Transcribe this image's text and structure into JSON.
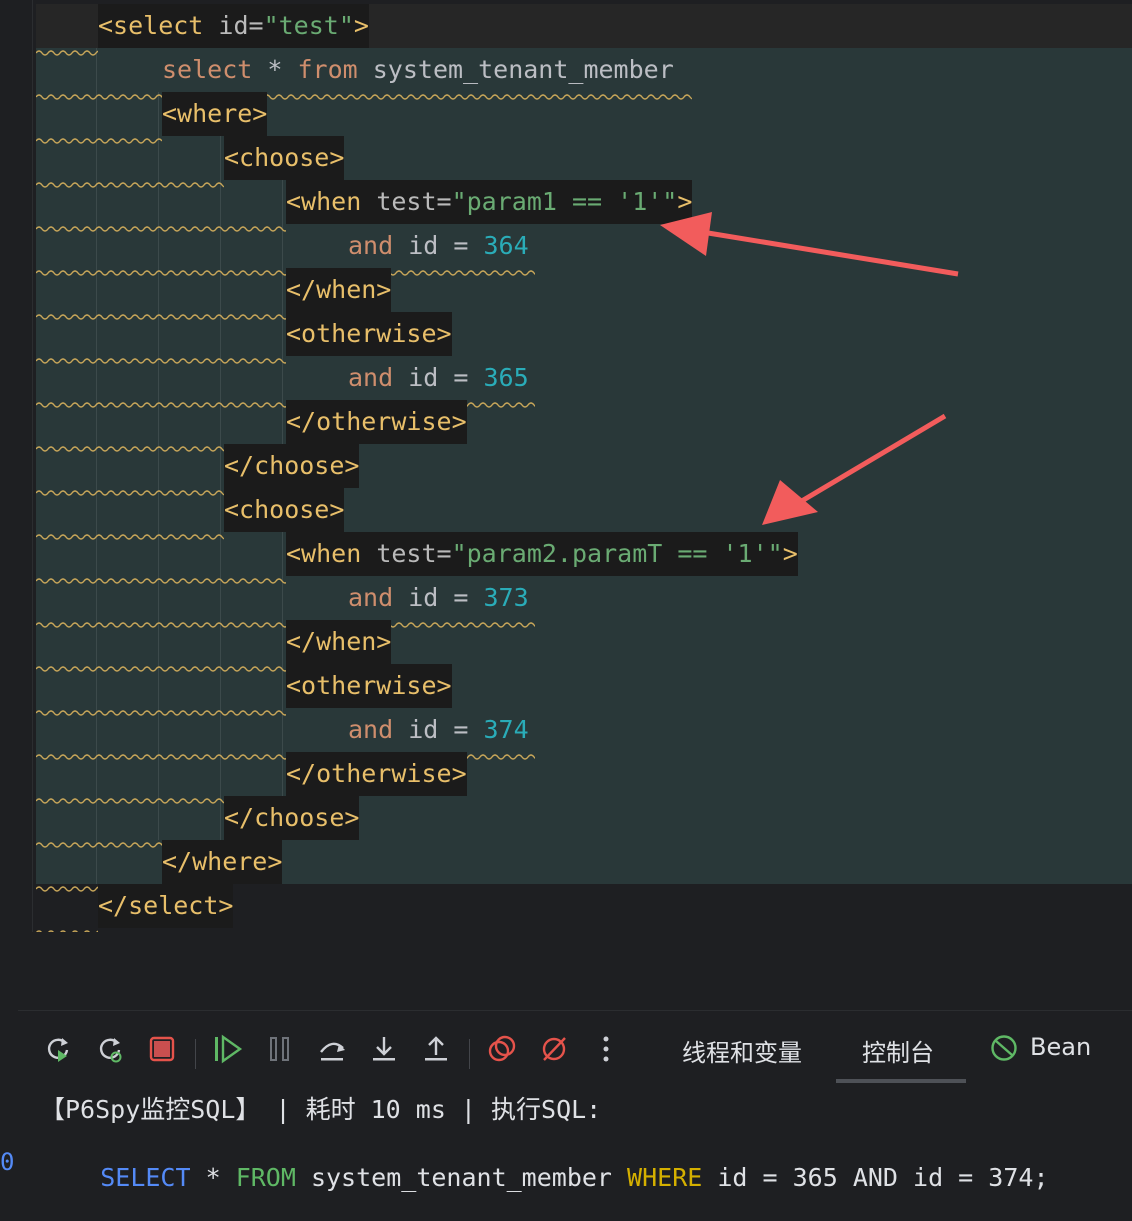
{
  "editor": {
    "lines": [
      {
        "t": "<select",
        "a": " id=",
        "s": "\"test\"",
        "t2": ">"
      },
      {
        "k": "select",
        "op": " * ",
        "k2": "from",
        "i": " system_tenant_member"
      },
      {
        "t": "<where>"
      },
      {
        "t": "<choose>"
      },
      {
        "t": "<when",
        "a": " test=",
        "s": "\"param1 == '1'\"",
        "t2": ">"
      },
      {
        "k": "and",
        "i": " id = ",
        "n": "364"
      },
      {
        "t": "</when>"
      },
      {
        "t": "<otherwise>"
      },
      {
        "k": "and",
        "i": " id = ",
        "n": "365"
      },
      {
        "t": "</otherwise>"
      },
      {
        "t": "</choose>"
      },
      {
        "t": "<choose>"
      },
      {
        "t": "<when",
        "a": " test=",
        "s": "\"param2.paramT == '1'\"",
        "t2": ">"
      },
      {
        "k": "and",
        "i": " id = ",
        "n": "373"
      },
      {
        "t": "</when>"
      },
      {
        "t": "<otherwise>"
      },
      {
        "k": "and",
        "i": " id = ",
        "n": "374"
      },
      {
        "t": "</otherwise>"
      },
      {
        "t": "</choose>"
      },
      {
        "t": "</where>"
      },
      {
        "t": "</select>"
      }
    ]
  },
  "debug_toolbar": {
    "tabs": [
      {
        "label": "线程和变量"
      },
      {
        "label": "控制台"
      },
      {
        "label": "Bean"
      }
    ]
  },
  "console": {
    "line1": "【P6Spy监控SQL】 | 耗时 10 ms | 执行SQL:",
    "sql": {
      "select": "SELECT",
      "star": " * ",
      "from": "FROM",
      "table": " system_tenant_member ",
      "where": "WHERE",
      "cond": " id = 365 AND id = 374;"
    },
    "gutter_marker": "0"
  },
  "colors": {
    "tag": "#e8bf6a",
    "string": "#6aab73",
    "keyword": "#cf8e6d",
    "number": "#2aacb8",
    "arrow": "#f25c5c"
  }
}
